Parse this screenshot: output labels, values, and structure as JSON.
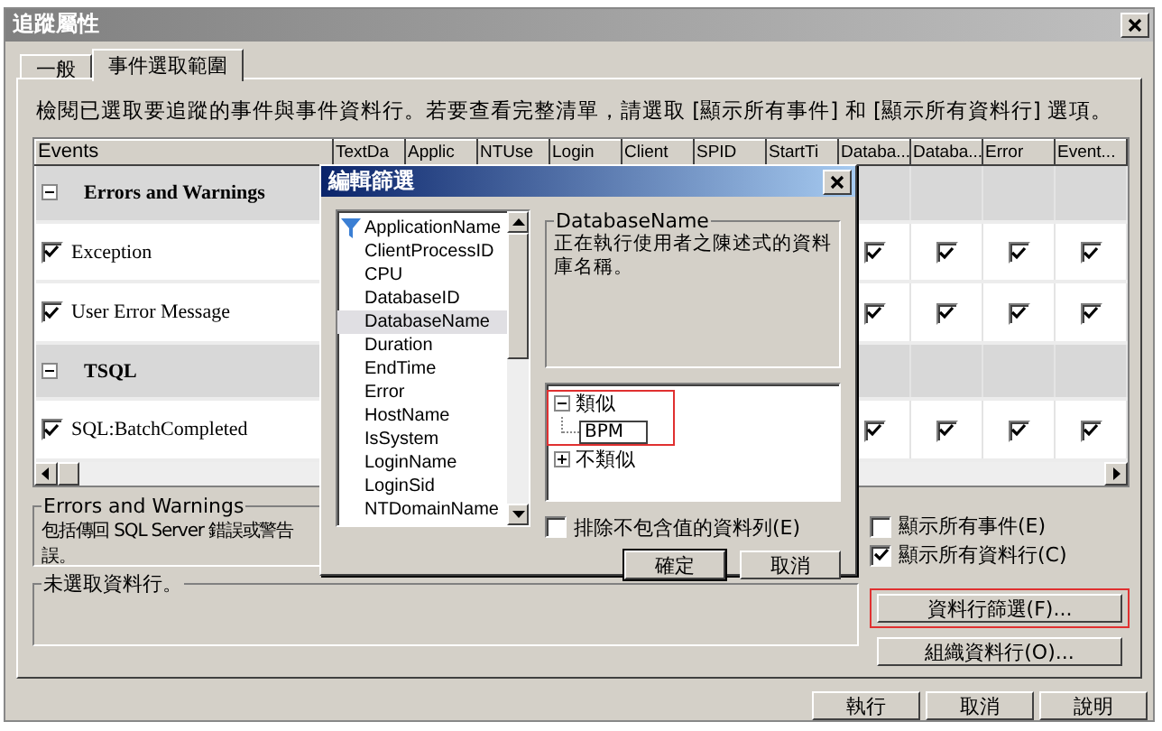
{
  "window": {
    "title": "追蹤屬性"
  },
  "tabs": [
    {
      "label": "一般",
      "selected": false
    },
    {
      "label": "事件選取範圍",
      "selected": true
    }
  ],
  "description": "檢閱已選取要追蹤的事件與事件資料行。若要查看完整清單，請選取 [顯示所有事件] 和 [顯示所有資料行] 選項。",
  "grid": {
    "columns": [
      "Events",
      "TextDa",
      "Applic",
      "NTUse",
      "Login",
      "Client",
      "SPID",
      "StartTi",
      "Databa...",
      "Databa...",
      "Error",
      "Event..."
    ],
    "rows": [
      {
        "kind": "group",
        "label": "Errors and Warnings",
        "expanded": true
      },
      {
        "kind": "event",
        "label": "Exception",
        "checked": true,
        "cells": [
          true,
          true,
          true,
          true
        ]
      },
      {
        "kind": "event",
        "label": "User Error Message",
        "checked": true,
        "cells": [
          true,
          true,
          true,
          true
        ]
      },
      {
        "kind": "group",
        "label": "TSQL",
        "expanded": true
      },
      {
        "kind": "event",
        "label": "SQL:BatchCompleted",
        "checked": true,
        "cells": [
          true,
          true,
          true,
          true
        ]
      }
    ]
  },
  "event_info": {
    "title": "Errors and Warnings",
    "lines": [
      "包括傳回 SQL Server 錯誤或警告",
      "誤。"
    ]
  },
  "column_info": {
    "title": "未選取資料行。"
  },
  "options": [
    {
      "label": "顯示所有事件(E)",
      "checked": false
    },
    {
      "label": "顯示所有資料行(C)",
      "checked": true
    }
  ],
  "side_buttons": [
    {
      "label": "資料行篩選(F)...",
      "highlighted": true
    },
    {
      "label": "組織資料行(O)...",
      "highlighted": false
    }
  ],
  "buttons": [
    "執行",
    "取消",
    "說明"
  ],
  "dialog": {
    "title": "編輯篩選",
    "columns": [
      {
        "label": "ApplicationName",
        "filtered": true,
        "selected": false
      },
      {
        "label": "ClientProcessID",
        "filtered": false,
        "selected": false
      },
      {
        "label": "CPU",
        "filtered": false,
        "selected": false
      },
      {
        "label": "DatabaseID",
        "filtered": false,
        "selected": false
      },
      {
        "label": "DatabaseName",
        "filtered": false,
        "selected": true
      },
      {
        "label": "Duration",
        "filtered": false,
        "selected": false
      },
      {
        "label": "EndTime",
        "filtered": false,
        "selected": false
      },
      {
        "label": "Error",
        "filtered": false,
        "selected": false
      },
      {
        "label": "HostName",
        "filtered": false,
        "selected": false
      },
      {
        "label": "IsSystem",
        "filtered": false,
        "selected": false
      },
      {
        "label": "LoginName",
        "filtered": false,
        "selected": false
      },
      {
        "label": "LoginSid",
        "filtered": false,
        "selected": false
      },
      {
        "label": "NTDomainName",
        "filtered": false,
        "selected": false
      }
    ],
    "info_title": "DatabaseName",
    "info_text": "正在執行使用者之陳述式的資料庫名稱。",
    "conditions": [
      {
        "label": "類似",
        "expanded": true,
        "highlighted": true,
        "children": [
          {
            "value": "BPM"
          }
        ]
      },
      {
        "label": "不類似",
        "expanded": false,
        "highlighted": false
      }
    ],
    "exclude": {
      "label": "排除不包含值的資料列(E)",
      "checked": false
    },
    "buttons": [
      "確定",
      "取消"
    ]
  }
}
